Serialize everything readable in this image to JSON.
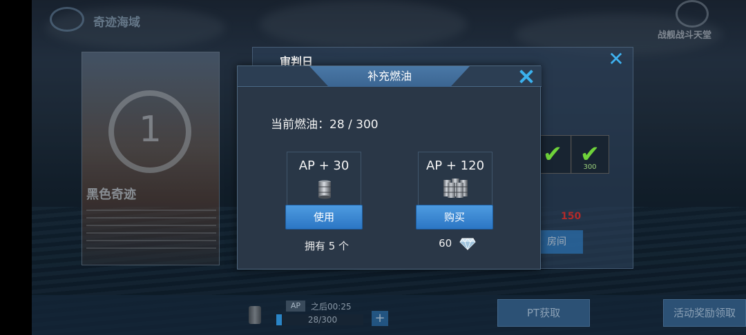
{
  "background": {
    "event_title": "奇迹海域",
    "top_right_label": "战舰战斗天堂",
    "event_card_name": "黑色奇迹",
    "event_card_number": "1",
    "panel_title": "审判日",
    "check_caption": "300",
    "cost_value": "150",
    "room_button_label": "房间",
    "ap_tag": "AP",
    "ap_timer": "之后00:25",
    "fuel_bar_text": "28/300",
    "plus_label": "+",
    "pt_button_label": "PT获取",
    "reward_button_label": "活动奖励领取"
  },
  "modal": {
    "title": "补充燃油",
    "fuel_label": "当前燃油：28 / 300",
    "items": [
      {
        "reward": "AP + 30",
        "button_label": "使用",
        "footer": "拥有 5 个",
        "icon": "fuel-barrel-icon"
      },
      {
        "reward": "AP + 120",
        "button_label": "购买",
        "price": "60",
        "icon": "fuel-barrels-stack-icon",
        "currency_icon": "diamond-icon"
      }
    ]
  },
  "colors": {
    "accent_blue": "#3bb1ee",
    "button_blue": "#2c76c4",
    "modal_bg": "#2a3747",
    "cost_red": "#b22a2a"
  }
}
